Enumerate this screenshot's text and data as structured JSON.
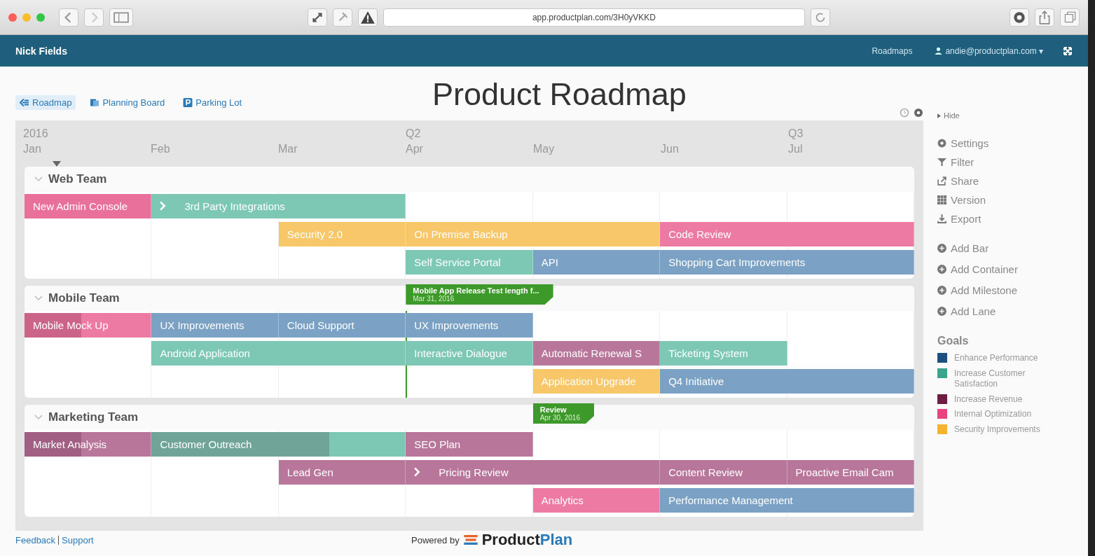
{
  "browser": {
    "url": "app.productplan.com/3H0yVKKD"
  },
  "app_header": {
    "account": "Nick Fields",
    "nav_link": "Roadmaps",
    "user": "andie@productplan.com ▾"
  },
  "view_tabs": [
    {
      "label": "Roadmap",
      "selected": true
    },
    {
      "label": "Planning Board",
      "selected": false
    },
    {
      "label": "Parking Lot",
      "selected": false
    }
  ],
  "title": "Product Roadmap",
  "timeline": {
    "months": [
      {
        "label": "Jan",
        "period": "2016"
      },
      {
        "label": "Feb"
      },
      {
        "label": "Mar"
      },
      {
        "label": "Apr",
        "period": "Q2"
      },
      {
        "label": "May"
      },
      {
        "label": "Jun"
      },
      {
        "label": "Jul",
        "period": "Q3"
      }
    ]
  },
  "teams": [
    {
      "name": "Web Team",
      "expanded": true,
      "lanes": [
        [
          {
            "kind": "bar",
            "label": "New Admin Console",
            "color": "#e8709a"
          },
          {
            "kind": "bar",
            "label": "3rd Party Integrations",
            "color": "#7cc8b5",
            "linked": true
          },
          {
            "kind": "cont"
          },
          {
            "kind": "empty"
          },
          {
            "kind": "empty"
          },
          {
            "kind": "empty"
          },
          {
            "kind": "empty"
          }
        ],
        [
          {
            "kind": "empty"
          },
          {
            "kind": "empty"
          },
          {
            "kind": "bar",
            "label": "Security 2.0",
            "color": "#f7c76a"
          },
          {
            "kind": "bar",
            "label": "On Premise Backup",
            "color": "#f7c76a"
          },
          {
            "kind": "cont"
          },
          {
            "kind": "bar",
            "label": "Code Review",
            "color": "#ec7aa3"
          },
          {
            "kind": "cont"
          }
        ],
        [
          {
            "kind": "empty"
          },
          {
            "kind": "empty"
          },
          {
            "kind": "empty"
          },
          {
            "kind": "bar",
            "label": "Self Service Portal",
            "color": "#7cc8b5"
          },
          {
            "kind": "bar",
            "label": "API",
            "color": "#7ba2c4"
          },
          {
            "kind": "bar",
            "label": "Shopping Cart Improvements",
            "color": "#7ba2c4"
          },
          {
            "kind": "cont"
          }
        ]
      ]
    },
    {
      "name": "Mobile Team",
      "expanded": true,
      "milestone_lane": [
        {
          "kind": "empty"
        },
        {
          "kind": "empty"
        },
        {
          "kind": "empty"
        },
        {
          "kind": "milestone",
          "label": "Mobile App Release Test length f...",
          "date": "Mar 31, 2016",
          "line": true
        },
        {
          "kind": "empty"
        },
        {
          "kind": "empty"
        },
        {
          "kind": "empty"
        }
      ],
      "lanes": [
        [
          {
            "kind": "bar",
            "label": "Mobile Mock Up",
            "color": "#ec7aa3",
            "level": 0.45
          },
          {
            "kind": "bar",
            "label": "UX Improvements",
            "color": "#7ba2c4"
          },
          {
            "kind": "bar",
            "label": "Cloud Support",
            "color": "#7ba2c4"
          },
          {
            "kind": "bar",
            "label": "UX Improvements",
            "color": "#7ba2c4"
          },
          {
            "kind": "empty"
          },
          {
            "kind": "empty"
          },
          {
            "kind": "empty"
          }
        ],
        [
          {
            "kind": "empty"
          },
          {
            "kind": "bar",
            "label": "Android Application",
            "color": "#7cc8b5"
          },
          {
            "kind": "cont"
          },
          {
            "kind": "bar",
            "label": "Interactive Dialogue",
            "color": "#7cc8b5"
          },
          {
            "kind": "bar",
            "label": "Automatic Renewal S",
            "color": "#b8769a"
          },
          {
            "kind": "bar",
            "label": "Ticketing System",
            "color": "#7cc8b5"
          },
          {
            "kind": "empty"
          }
        ],
        [
          {
            "kind": "empty"
          },
          {
            "kind": "empty"
          },
          {
            "kind": "empty"
          },
          {
            "kind": "empty"
          },
          {
            "kind": "bar",
            "label": "Application Upgrade",
            "color": "#f7c76a"
          },
          {
            "kind": "bar",
            "label": "Q4 Initiative",
            "color": "#7ba2c4"
          },
          {
            "kind": "cont"
          }
        ]
      ]
    },
    {
      "name": "Marketing Team",
      "expanded": true,
      "milestone_lane": [
        {
          "kind": "empty"
        },
        {
          "kind": "empty"
        },
        {
          "kind": "empty"
        },
        {
          "kind": "empty"
        },
        {
          "kind": "milestone",
          "label": "Review",
          "date": "Apr 30, 2016",
          "line": false
        },
        {
          "kind": "empty"
        },
        {
          "kind": "empty"
        }
      ],
      "lanes": [
        [
          {
            "kind": "bar",
            "label": "Market Analysis",
            "color": "#b8769a",
            "level": 0.45
          },
          {
            "kind": "bar",
            "label": "Customer Outreach",
            "color": "#7cc8b5",
            "level": 0.7
          },
          {
            "kind": "cont"
          },
          {
            "kind": "bar",
            "label": "SEO Plan",
            "color": "#b8769a"
          },
          {
            "kind": "empty"
          },
          {
            "kind": "empty"
          },
          {
            "kind": "empty"
          }
        ],
        [
          {
            "kind": "empty"
          },
          {
            "kind": "empty"
          },
          {
            "kind": "bar",
            "label": "Lead Gen",
            "color": "#b8769a"
          },
          {
            "kind": "bar",
            "label": "Pricing Review",
            "color": "#b8769a",
            "linked": true
          },
          {
            "kind": "cont"
          },
          {
            "kind": "bar",
            "label": "Content Review",
            "color": "#b8769a"
          },
          {
            "kind": "bar",
            "label": "Proactive Email Cam",
            "color": "#b8769a"
          }
        ],
        [
          {
            "kind": "empty"
          },
          {
            "kind": "empty"
          },
          {
            "kind": "empty"
          },
          {
            "kind": "empty"
          },
          {
            "kind": "bar",
            "label": "Analytics",
            "color": "#ec7aa3"
          },
          {
            "kind": "bar",
            "label": "Performance Management",
            "color": "#7ba2c4"
          },
          {
            "kind": "cont"
          }
        ]
      ]
    }
  ],
  "sidebar": {
    "hide": "Hide",
    "actions": [
      "Settings",
      "Filter",
      "Share",
      "Version",
      "Export"
    ],
    "add_actions": [
      "Add Bar",
      "Add Container",
      "Add Milestone",
      "Add Lane"
    ],
    "goals_title": "Goals",
    "goals": [
      {
        "label": "Enhance Performance",
        "color": "#1d4f80"
      },
      {
        "label": "Increase Customer Satisfaction",
        "color": "#3aa58a"
      },
      {
        "label": "Increase Revenue",
        "color": "#6d1d42"
      },
      {
        "label": "Internal Optimization",
        "color": "#e8437f"
      },
      {
        "label": "Security Improvements",
        "color": "#f4b431"
      }
    ]
  },
  "footer": {
    "links": [
      "Feedback",
      "Support"
    ],
    "powered_by": "Powered by",
    "logo": [
      "Product",
      "Plan"
    ]
  }
}
